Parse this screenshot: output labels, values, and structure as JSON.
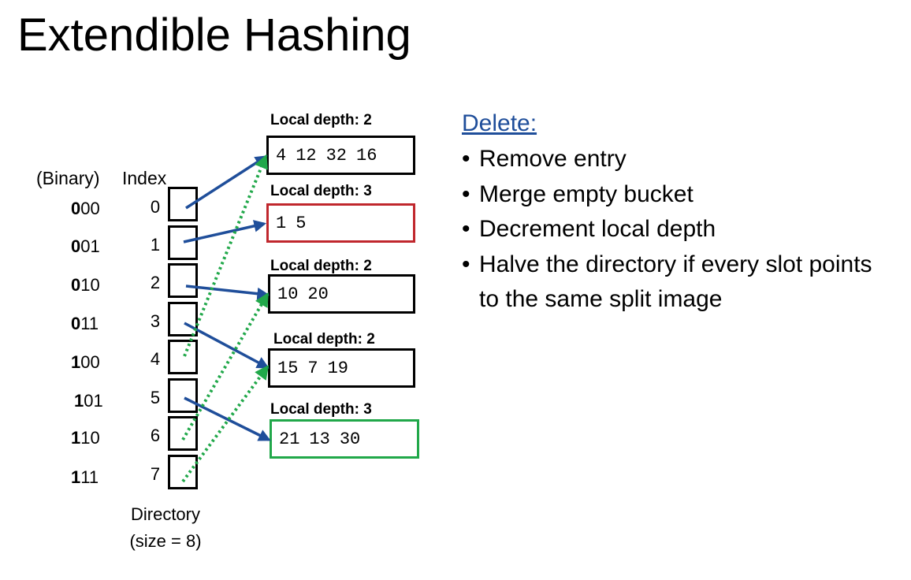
{
  "title": "Extendible Hashing",
  "headers": {
    "binary": "(Binary)",
    "index": "Index"
  },
  "slots": [
    {
      "bold": "0",
      "rest": "00",
      "index": "0"
    },
    {
      "bold": "0",
      "rest": "01",
      "index": "1"
    },
    {
      "bold": "0",
      "rest": "10",
      "index": "2"
    },
    {
      "bold": "0",
      "rest": "11",
      "index": "3"
    },
    {
      "bold": "1",
      "rest": "00",
      "index": "4"
    },
    {
      "bold": "1",
      "rest": "01",
      "index": "5"
    },
    {
      "bold": "1",
      "rest": "10",
      "index": "6"
    },
    {
      "bold": "1",
      "rest": "11",
      "index": "7"
    }
  ],
  "directory": {
    "label": "Directory",
    "size_label": "(size = 8)"
  },
  "buckets": [
    {
      "depth_label": "Local depth: 2",
      "entries": [
        "4",
        "12",
        "32",
        "16"
      ],
      "border_color": "#000000"
    },
    {
      "depth_label": "Local depth: 3",
      "entries": [
        "1",
        "5"
      ],
      "border_color": "#c0272d"
    },
    {
      "depth_label": "Local depth: 2",
      "entries": [
        "10",
        "20"
      ],
      "border_color": "#000000"
    },
    {
      "depth_label": "Local depth: 2",
      "entries": [
        "15",
        "7",
        "19"
      ],
      "border_color": "#000000"
    },
    {
      "depth_label": "Local depth: 3",
      "entries": [
        "21",
        "13",
        "30"
      ],
      "border_color": "#21a84a"
    }
  ],
  "pointers": [
    {
      "slot": 0,
      "bucket": 0,
      "style": "solid"
    },
    {
      "slot": 1,
      "bucket": 1,
      "style": "solid"
    },
    {
      "slot": 2,
      "bucket": 2,
      "style": "solid"
    },
    {
      "slot": 3,
      "bucket": 3,
      "style": "solid"
    },
    {
      "slot": 4,
      "bucket": 0,
      "style": "dotted"
    },
    {
      "slot": 5,
      "bucket": 4,
      "style": "solid"
    },
    {
      "slot": 6,
      "bucket": 2,
      "style": "dotted"
    },
    {
      "slot": 7,
      "bucket": 3,
      "style": "dotted"
    }
  ],
  "colors": {
    "solid_arrow": "#1f4e9a",
    "dotted_arrow": "#21a84a",
    "heading": "#1f4e9a"
  },
  "operations": {
    "title": "Delete:",
    "items": [
      "Remove entry",
      "Merge empty bucket",
      "Decrement local depth",
      "Halve the directory if every slot points to the same split image"
    ]
  }
}
